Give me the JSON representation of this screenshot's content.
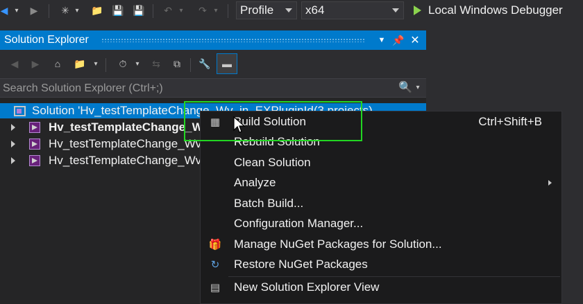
{
  "toolbar": {
    "profile_value": "Profile",
    "platform_value": "x64",
    "run_label": "Local Windows Debugger",
    "accent_green": "#8bd34e"
  },
  "solution_explorer": {
    "title": "Solution Explorer",
    "search_placeholder": "Search Solution Explorer (Ctrl+;)",
    "tree": [
      {
        "label": "Solution 'Hv_testTemplateChange_Wv_in_EXPluginId(3 projects)",
        "type": "solution",
        "selected": true
      },
      {
        "label": "Hv_testTemplateChange_W",
        "type": "project",
        "bold": true
      },
      {
        "label": "Hv_testTemplateChange_Wv",
        "type": "project"
      },
      {
        "label": "Hv_testTemplateChange_Wv",
        "type": "project"
      }
    ]
  },
  "context_menu": {
    "items": [
      {
        "label": "Build Solution",
        "shortcut": "Ctrl+Shift+B",
        "icon": "build-solution-icon"
      },
      {
        "label": "Rebuild Solution"
      },
      {
        "label": "Clean Solution"
      },
      {
        "label": "Analyze",
        "submenu": true
      },
      {
        "label": "Batch Build..."
      },
      {
        "label": "Configuration Manager..."
      },
      {
        "label": "Manage NuGet Packages for Solution...",
        "icon": "nuget-icon"
      },
      {
        "label": "Restore NuGet Packages",
        "icon": "restore-icon"
      },
      {
        "label": "New Solution Explorer View",
        "icon": "new-view-icon"
      }
    ]
  },
  "colors": {
    "accent": "#007acc",
    "highlight_box": "#22d622"
  }
}
